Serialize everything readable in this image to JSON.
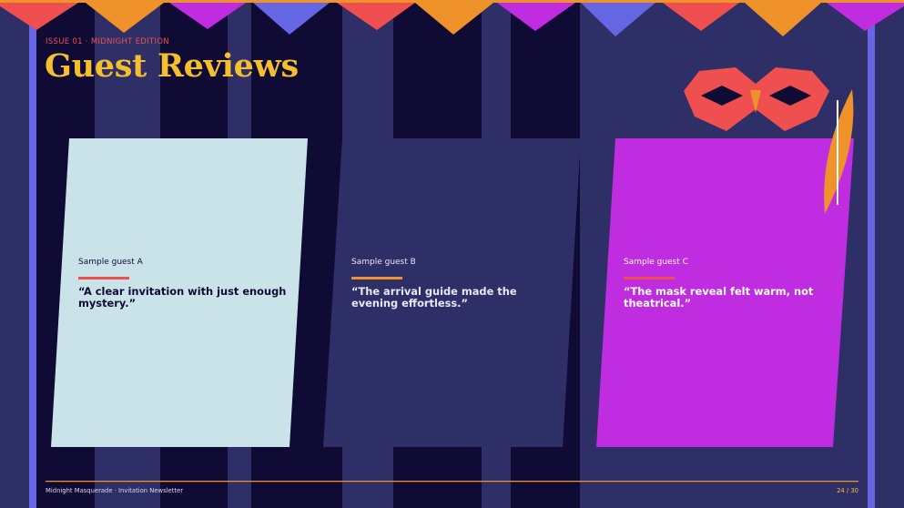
{
  "slide": {
    "kicker": "ISSUE 01 · MIDNIGHT EDITION",
    "title": "Guest Reviews"
  },
  "cards": [
    {
      "guest": "Sample guest A",
      "quote": "“A clear invitation with just enough mystery.”",
      "card_color": "#c9e3e8",
      "text_color": "#0f0b35",
      "accent": "#ef4f4f"
    },
    {
      "guest": "Sample guest B",
      "quote": "“The arrival guide made the evening effortless.”",
      "card_color": "#2e2f66",
      "text_color": "#e9e7f7",
      "accent": "#f0922a"
    },
    {
      "guest": "Sample guest C",
      "quote": "“The mask reveal felt warm, not theatrical.”",
      "card_color": "#c02ce0",
      "text_color": "#ffffff",
      "accent": "#ef4f4f"
    }
  ],
  "footer": {
    "left": "Midnight Masquerade · Invitation Newsletter",
    "page": "24 / 30"
  },
  "colors": {
    "background": "#0f0b35",
    "stripe": "#2e2f66",
    "edge_bar": "#6665e3",
    "title": "#f5be2e",
    "kicker": "#ef4f4f",
    "rule": "#f0922a",
    "mask": "#ef4f4f",
    "feather": "#f0922a"
  },
  "icons": {
    "banner": "bunting-garland",
    "mask": "masquerade-mask-icon",
    "feather": "feather-icon"
  }
}
